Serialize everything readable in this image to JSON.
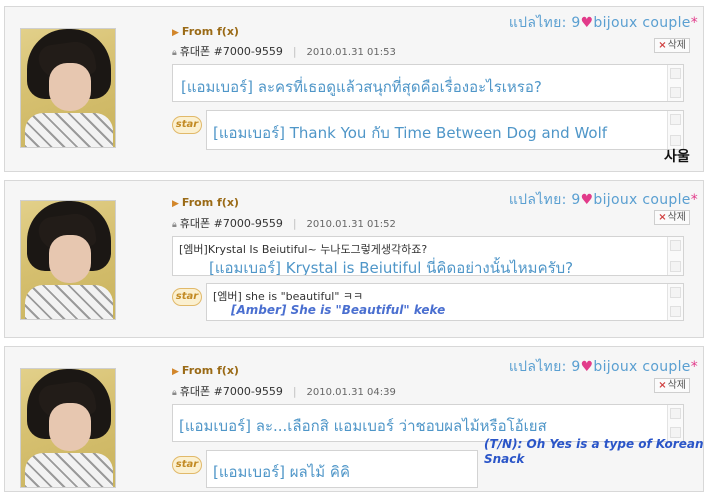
{
  "posts": [
    {
      "from_label": "From f(x)",
      "phone": "휴대폰 #7000-9559",
      "date": "2010.01.31 01:53",
      "credit_prefix": "แปลไทย: 9",
      "credit_suffix": "bijoux couple",
      "delete_label": "삭제",
      "comment": "[แอมเบอร์] ละครที่เธอดูแล้วสนุกที่สุดคือเรื่องอะไรเหรอ?",
      "star_label": "star",
      "reply": "[แอมเบอร์] Thank You กับ Time Between Dog and Wolf",
      "signature": "사울"
    },
    {
      "from_label": "From f(x)",
      "phone": "휴대폰 #7000-9559",
      "date": "2010.01.31 01:52",
      "credit_prefix": "แปลไทย: 9",
      "credit_suffix": "bijoux couple",
      "delete_label": "삭제",
      "comment_original": "[엠버]Krystal Is Beiutiful~ 누나도그렇게생각하죠?",
      "comment": "[แอมเบอร์] Krystal is Beiutiful นี่คิดอย่างนั้นไหมครับ?",
      "star_label": "star",
      "reply_original": "[엠버] she is \"beautiful\" ㅋㅋ",
      "reply": "[Amber] She is \"Beautiful\" keke"
    },
    {
      "from_label": "From f(x)",
      "phone": "휴대폰 #7000-9559",
      "date": "2010.01.31 04:39",
      "credit_prefix": "แปลไทย: 9",
      "credit_suffix": "bijoux couple",
      "delete_label": "삭제",
      "comment": "[แอมเบอร์] ละ...เลือกสิ แอมเบอร์ ว่าชอบผลไม้หรือโอ้เยส",
      "star_label": "star",
      "reply": "[แอมเบอร์] ผลไม้ คิคิ",
      "translator_note": "(T/N): Oh Yes is a type of Korean Snack"
    }
  ],
  "colors": {
    "accent_blue": "#4f96c8",
    "from_orange": "#9a6a16",
    "star_gold": "#c28a23",
    "heart_pink": "#e23b8a",
    "note_blue": "#2a55c8"
  },
  "icons": [
    "arrow-icon",
    "lock-icon",
    "heart-icon",
    "delete-icon"
  ]
}
